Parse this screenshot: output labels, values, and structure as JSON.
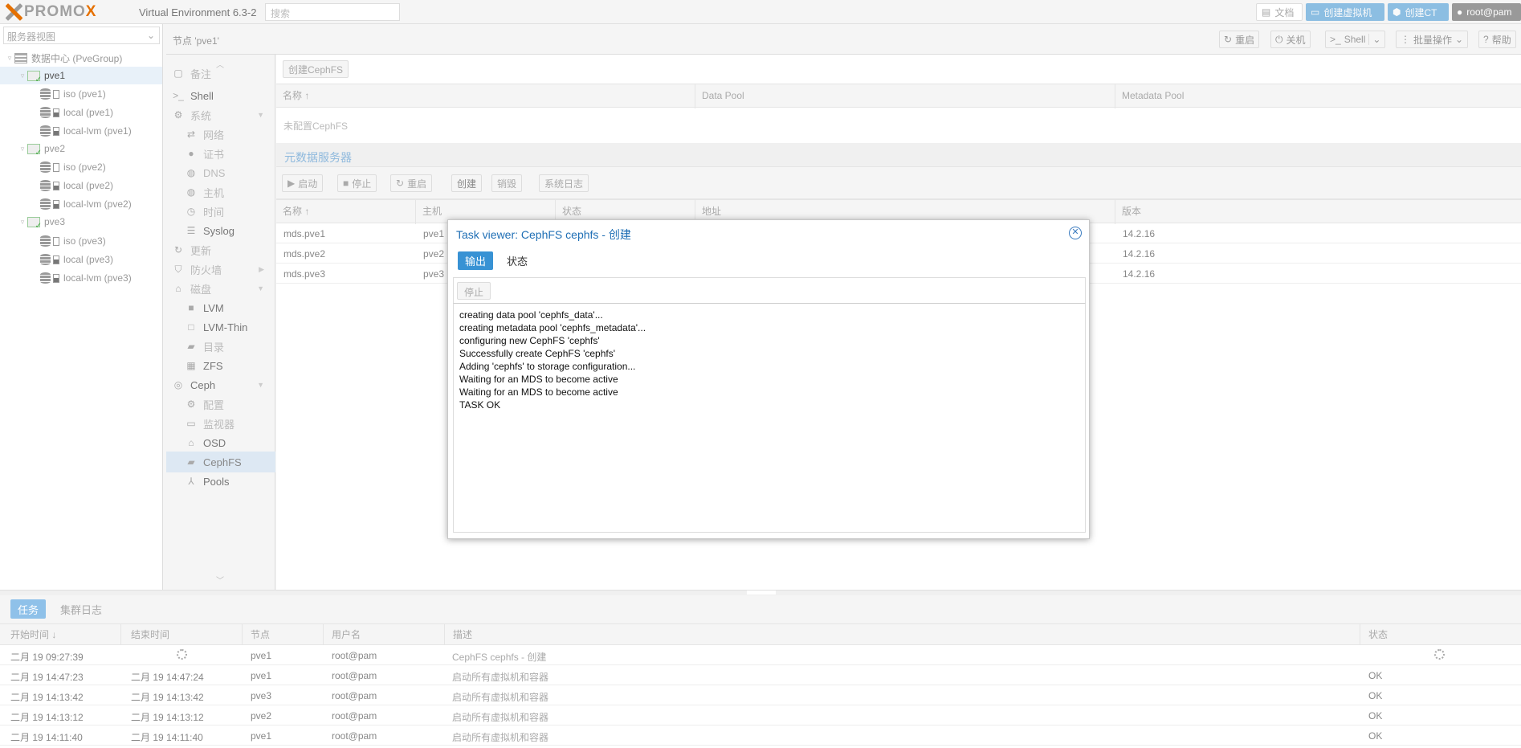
{
  "topbar": {
    "logo_prefix": "PRO",
    "logo_x": "X",
    "logo_mid": "MO",
    "logo_x2": "X",
    "title": "Virtual Environment 6.3-2",
    "search_placeholder": "搜索",
    "docs_label": "文档",
    "create_vm_label": "创建虚拟机",
    "create_ct_label": "创建CT",
    "user_label": "root@pam"
  },
  "tree": {
    "view": "服务器视图",
    "datacenter": "数据中心 (PveGroup)",
    "nodes": [
      {
        "name": "pve1",
        "storages": [
          "iso (pve1)",
          "local (pve1)",
          "local-lvm (pve1)"
        ]
      },
      {
        "name": "pve2",
        "storages": [
          "iso (pve2)",
          "local (pve2)",
          "local-lvm (pve2)"
        ]
      },
      {
        "name": "pve3",
        "storages": [
          "iso (pve3)",
          "local (pve3)",
          "local-lvm (pve3)"
        ]
      }
    ]
  },
  "breadcrumb": "节点 'pve1'",
  "toolbar": {
    "reboot": "重启",
    "shutdown": "关机",
    "shell": "Shell",
    "bulk": "批量操作",
    "help": "帮助"
  },
  "nav": {
    "notes": "备注",
    "shell": "Shell",
    "system": "系统",
    "network": "网络",
    "certs": "证书",
    "dns": "DNS",
    "hosts": "主机",
    "time": "时间",
    "syslog": "Syslog",
    "updates": "更新",
    "firewall": "防火墙",
    "disks": "磁盘",
    "lvm": "LVM",
    "lvmthin": "LVM-Thin",
    "directory": "目录",
    "zfs": "ZFS",
    "ceph": "Ceph",
    "config": "配置",
    "monitor": "监视器",
    "osd": "OSD",
    "cephfs": "CephFS",
    "pools": "Pools"
  },
  "cephfs": {
    "create_button": "创建CephFS",
    "columns": [
      "名称 ↑",
      "Data Pool",
      "Metadata Pool"
    ],
    "empty_text": "未配置CephFS"
  },
  "mds": {
    "title": "元数据服务器",
    "buttons": {
      "start": "启动",
      "stop": "停止",
      "restart": "重启",
      "create": "创建",
      "destroy": "销毁",
      "syslog": "系统日志"
    },
    "columns": [
      "名称 ↑",
      "主机",
      "状态",
      "地址",
      "版本"
    ],
    "rows": [
      {
        "name": "mds.pve1",
        "host": "pve1",
        "version": "14.2.16"
      },
      {
        "name": "mds.pve2",
        "host": "pve2",
        "version": "14.2.16"
      },
      {
        "name": "mds.pve3",
        "host": "pve3",
        "version": "14.2.16"
      }
    ]
  },
  "task_viewer": {
    "title_prefix": "Task viewer: CephFS cephfs - ",
    "title_action": "创建",
    "tabs": [
      "输出",
      "状态"
    ],
    "stop_button": "停止",
    "log": [
      "creating data pool 'cephfs_data'...",
      "creating metadata pool 'cephfs_metadata'...",
      "configuring new CephFS 'cephfs'",
      "Successfully create CephFS 'cephfs'",
      "Adding 'cephfs' to storage configuration...",
      "Waiting for an MDS to become active",
      "Waiting for an MDS to become active",
      "TASK OK"
    ]
  },
  "bottom": {
    "tabs": [
      "任务",
      "集群日志"
    ],
    "columns": [
      "开始时间 ↓",
      "结束时间",
      "节点",
      "用户名",
      "描述",
      "状态"
    ],
    "rows": [
      {
        "start": "二月 19 09:27:39",
        "end": "",
        "node": "pve1",
        "user": "root@pam",
        "desc": "CephFS cephfs - 创建",
        "status": ""
      },
      {
        "start": "二月 19 14:47:23",
        "end": "二月 19 14:47:24",
        "node": "pve1",
        "user": "root@pam",
        "desc": "启动所有虚拟机和容器",
        "status": "OK"
      },
      {
        "start": "二月 19 14:13:42",
        "end": "二月 19 14:13:42",
        "node": "pve3",
        "user": "root@pam",
        "desc": "启动所有虚拟机和容器",
        "status": "OK"
      },
      {
        "start": "二月 19 14:13:12",
        "end": "二月 19 14:13:12",
        "node": "pve2",
        "user": "root@pam",
        "desc": "启动所有虚拟机和容器",
        "status": "OK"
      },
      {
        "start": "二月 19 14:11:40",
        "end": "二月 19 14:11:40",
        "node": "pve1",
        "user": "root@pam",
        "desc": "启动所有虚拟机和容器",
        "status": "OK"
      }
    ]
  }
}
